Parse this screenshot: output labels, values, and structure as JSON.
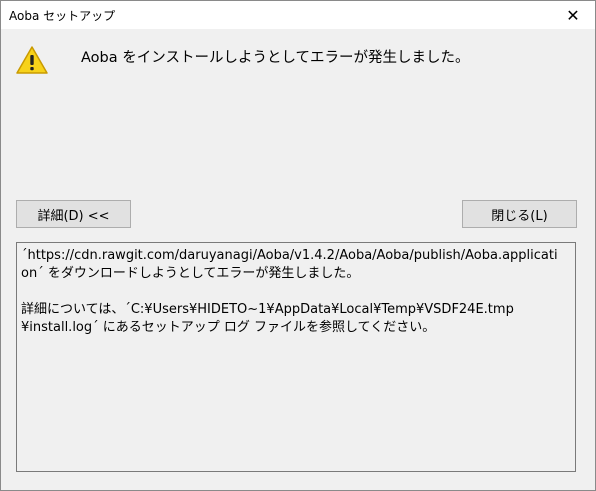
{
  "window": {
    "title": "Aoba セットアップ",
    "close_glyph": "✕"
  },
  "main": {
    "icon": "warning-icon",
    "message": "Aoba をインストールしようとしてエラーが発生しました。"
  },
  "buttons": {
    "details_label": "詳細(D) <<",
    "close_label": "閉じる(L)"
  },
  "details": {
    "text": "´https://cdn.rawgit.com/daruyanagi/Aoba/v1.4.2/Aoba/Aoba/publish/Aoba.applicati\non´ をダウンロードしようとしてエラーが発生しました。\n\n詳細については、´C:¥Users¥HIDETO~1¥AppData¥Local¥Temp¥VSDF24E.tmp\n¥install.log´ にあるセットアップ ログ ファイルを参照してください。"
  },
  "colors": {
    "warning_fill": "#f7d21a",
    "warning_stroke": "#c99a00",
    "details_border": "#7a7a7a"
  }
}
